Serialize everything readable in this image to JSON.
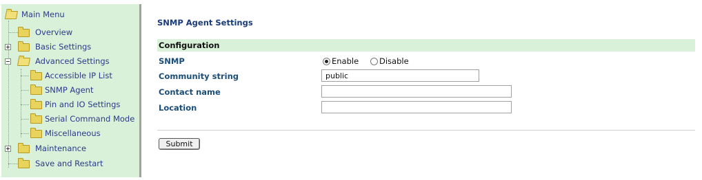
{
  "sidebar": {
    "title": "Main Menu",
    "items": [
      {
        "label": "Overview",
        "icon": "folder-icon"
      },
      {
        "label": "Basic Settings",
        "icon": "folder-icon",
        "expander": "plus"
      },
      {
        "label": "Advanced Settings",
        "icon": "folder-open-icon",
        "expander": "minus"
      },
      {
        "label": "Accessible IP List",
        "icon": "folder-icon"
      },
      {
        "label": "SNMP Agent",
        "icon": "folder-icon"
      },
      {
        "label": "Pin and IO Settings",
        "icon": "folder-icon"
      },
      {
        "label": "Serial Command Mode",
        "icon": "folder-icon"
      },
      {
        "label": "Miscellaneous",
        "icon": "folder-icon"
      },
      {
        "label": "Maintenance",
        "icon": "folder-icon",
        "expander": "plus"
      },
      {
        "label": "Save and Restart",
        "icon": "folder-icon"
      }
    ]
  },
  "main": {
    "title": "SNMP Agent Settings",
    "section": "Configuration",
    "snmp": {
      "label": "SNMP",
      "options": [
        "Enable",
        "Disable"
      ],
      "selected": "Enable"
    },
    "community": {
      "label": "Community string",
      "value": "public"
    },
    "contact": {
      "label": "Contact name",
      "value": ""
    },
    "location": {
      "label": "Location",
      "value": ""
    },
    "submit_label": "Submit"
  },
  "colors": {
    "sidebar_bg": "#d9f1d9",
    "section_bg": "#d9f1d9",
    "title_color": "#1a3b7a",
    "menu_text": "#2b3a8a"
  }
}
